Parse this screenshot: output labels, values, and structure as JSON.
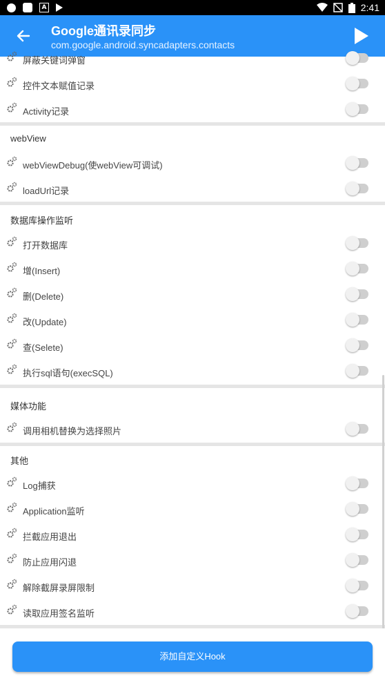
{
  "status_bar": {
    "time": "2:41"
  },
  "app_bar": {
    "title": "Google通讯录同步",
    "subtitle": "com.google.android.syncadapters.contacts"
  },
  "rows_top": [
    {
      "label": "屏蔽关键词弹窗"
    },
    {
      "label": "控件文本赋值记录"
    },
    {
      "label": "Activity记录"
    }
  ],
  "sections": [
    {
      "title": "webView",
      "items": [
        "webViewDebug(使webView可调试)",
        "loadUrl记录"
      ]
    },
    {
      "title": "数据库操作监听",
      "items": [
        "打开数据库",
        "增(Insert)",
        "删(Delete)",
        "改(Update)",
        "查(Selete)",
        "执行sql语句(execSQL)"
      ]
    },
    {
      "title": "媒体功能",
      "items": [
        "调用相机替换为选择照片"
      ]
    },
    {
      "title": "其他",
      "items": [
        "Log捕获",
        "Application监听",
        "拦截应用退出",
        "防止应用闪退",
        "解除截屏录屏限制",
        "读取应用签名监听"
      ]
    }
  ],
  "add_hook_button": {
    "label": "添加自定义Hook"
  },
  "colors": {
    "accent": "#2a92f8",
    "divider": "#e5e5e5",
    "toggle_off": "#cfcfcf"
  }
}
